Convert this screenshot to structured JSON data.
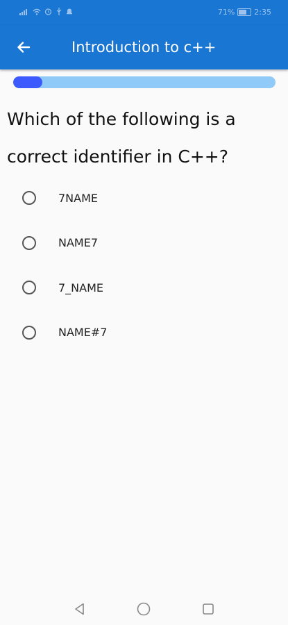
{
  "status_bar": {
    "left_icons": [
      "signal-icon",
      "wifi-icon",
      "alarm-icon",
      "usb-icon",
      "notification-icon"
    ],
    "battery_percent": "71%",
    "battery_level": 0.71,
    "time": "2:35"
  },
  "app_bar": {
    "back_icon": "arrow-back-icon",
    "title": "Introduction to c++",
    "background_color": "#1976d2"
  },
  "progress": {
    "fraction": 0.11,
    "fill_color": "#3d5afe",
    "track_color": "#90caf9"
  },
  "question": {
    "text": "Which of the following is a correct identifier in C++?"
  },
  "options": [
    {
      "label": "7NAME",
      "selected": false
    },
    {
      "label": "NAME7",
      "selected": false
    },
    {
      "label": "7_NAME",
      "selected": false
    },
    {
      "label": "NAME#7",
      "selected": false
    }
  ],
  "nav_bar": {
    "buttons": [
      "back-triangle-icon",
      "home-circle-icon",
      "recents-square-icon"
    ]
  }
}
